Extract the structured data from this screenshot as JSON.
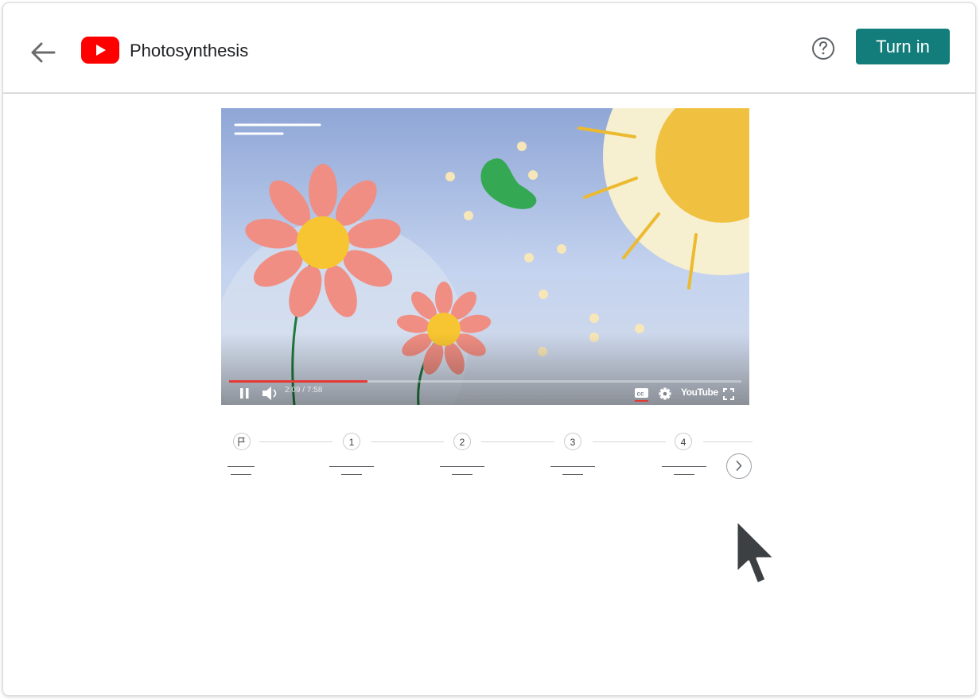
{
  "header": {
    "back_icon": "arrow-left-icon",
    "logo_icon": "youtube-logo-icon",
    "title": "Photosynthesis",
    "help_icon": "question-mark-circle-icon",
    "turn_in_label": "Turn in"
  },
  "video": {
    "time": "2:09 / 7:58",
    "progress": 0.27,
    "youtube_label": "YouTube",
    "controls": [
      "pause-icon",
      "volume-icon",
      "closed-captions-icon",
      "settings-gear-icon",
      "fullscreen-icon"
    ]
  },
  "timeline": {
    "nodes": [
      "",
      "1",
      "2",
      "3",
      "4"
    ],
    "start_icon": "flag-icon",
    "next_icon": "chevron-right-icon"
  },
  "colors": {
    "accent": "#127d7b",
    "youtube_red": "#ff0000",
    "progress_red": "#e53935"
  }
}
